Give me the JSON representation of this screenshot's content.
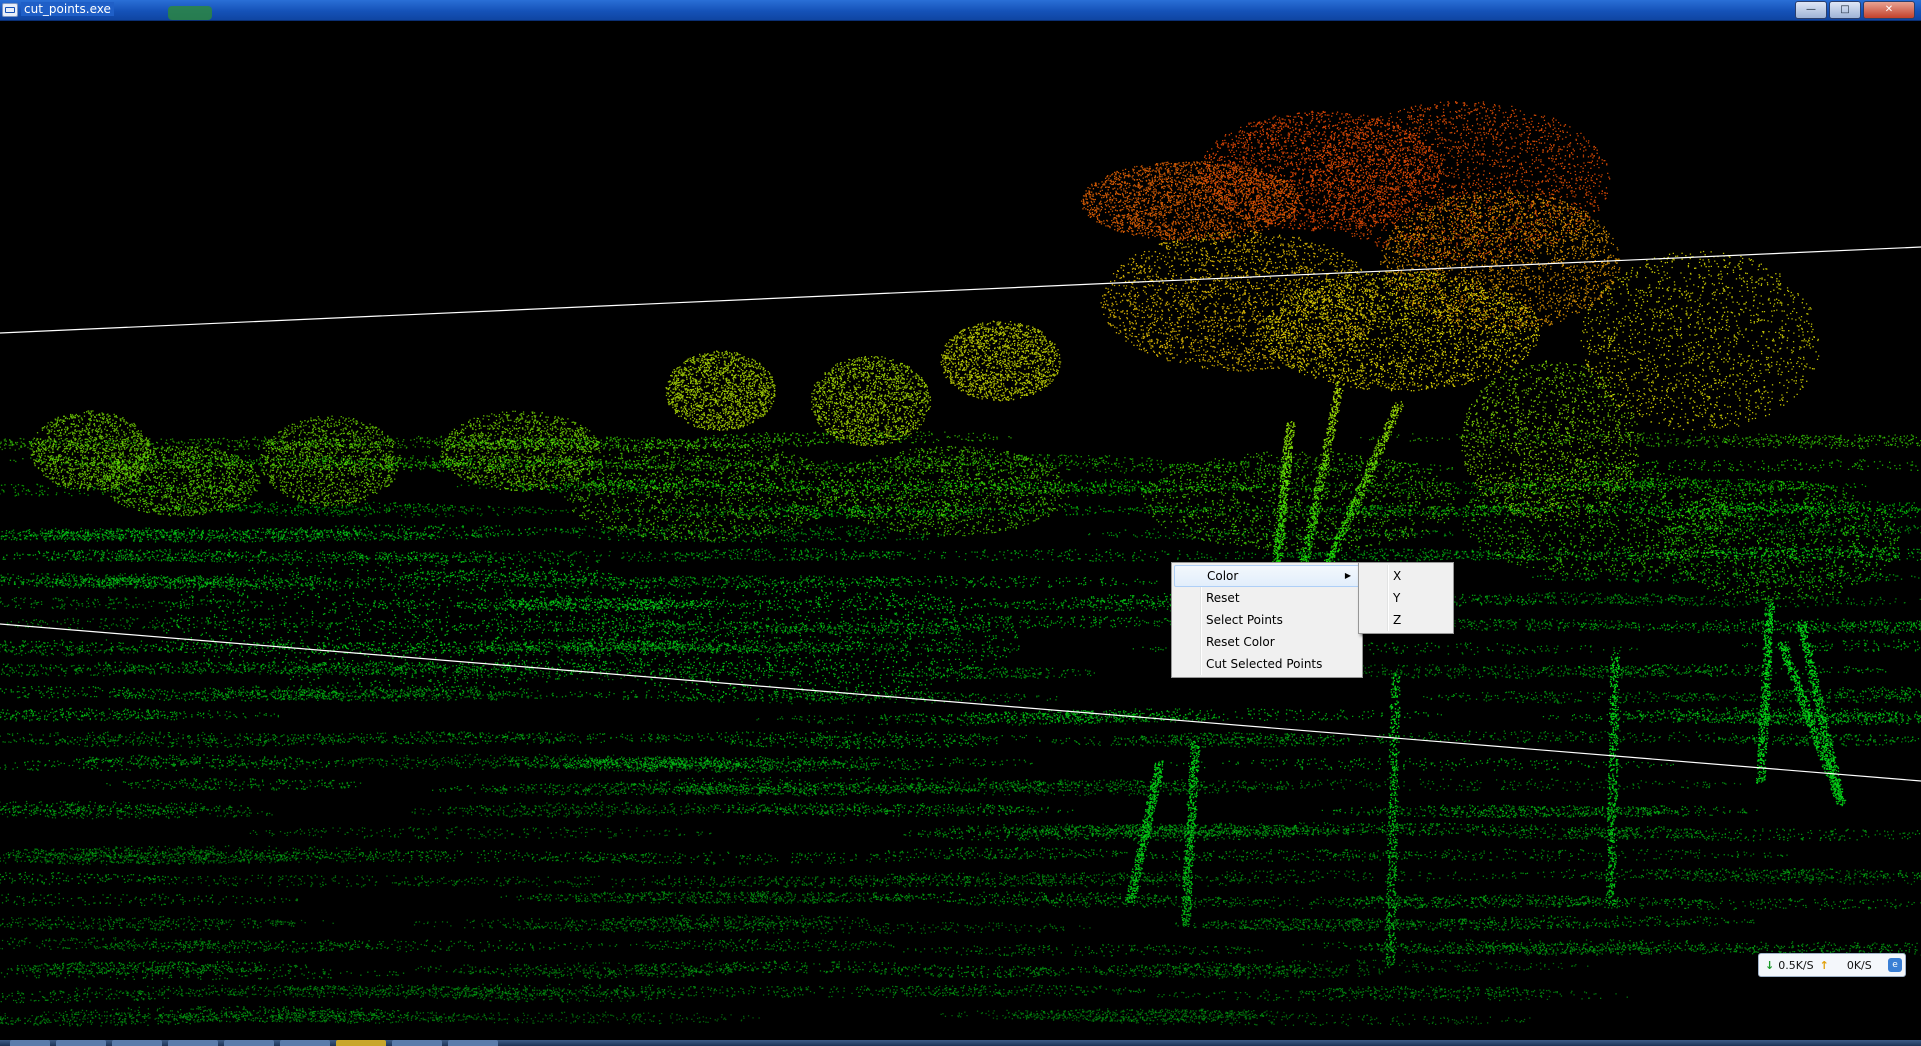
{
  "window": {
    "title": "cut_points.exe",
    "buttons": {
      "minimize": "—",
      "maximize": "□",
      "close": "✕"
    }
  },
  "context_menu": {
    "items": [
      {
        "label": "Color",
        "has_submenu": true,
        "highlighted": true
      },
      {
        "label": "Reset"
      },
      {
        "label": "Select Points"
      },
      {
        "label": "Reset Color"
      },
      {
        "label": "Cut Selected Points"
      }
    ],
    "submenu": [
      "X",
      "Y",
      "Z"
    ]
  },
  "network_widget": {
    "download": "0.5K/S",
    "upload": "0K/S",
    "icons": [
      "arrow-down-icon",
      "arrow-up-icon",
      "app-badge-icon"
    ]
  },
  "colors": {
    "background": "#000000",
    "point_low": "#22e63a",
    "point_mid": "#9acb12",
    "point_high": "#ff3a10",
    "title_bar": "#1552b8"
  }
}
